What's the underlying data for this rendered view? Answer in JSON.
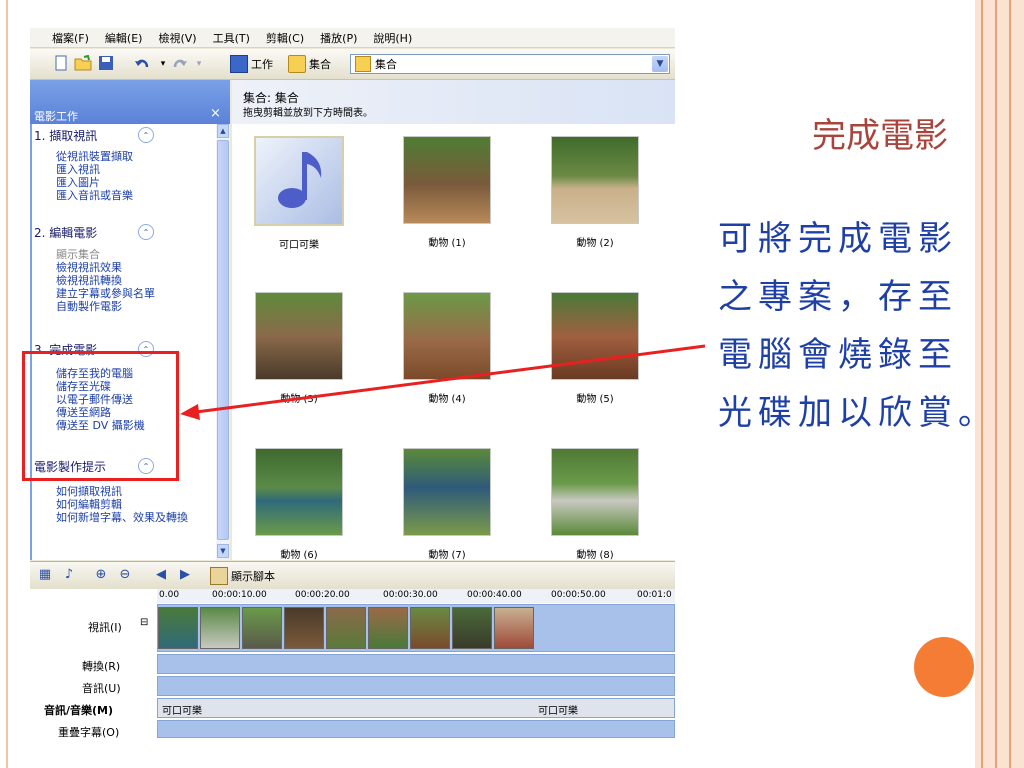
{
  "slide": {
    "title": "完成電影",
    "body_lines": [
      "可將完成電影",
      "之專案，存至",
      "電腦會燒錄至",
      "光碟加以欣賞。"
    ]
  },
  "colors": {
    "accent_orange": "#f47c35",
    "title_red": "#a8443c",
    "body_blue": "#1e3fa5",
    "highlight_red": "#e82020"
  },
  "menubar": [
    "檔案(F)",
    "編輯(E)",
    "檢視(V)",
    "工具(T)",
    "剪輯(C)",
    "播放(P)",
    "說明(H)"
  ],
  "toolbar": {
    "icons": [
      "new-icon",
      "open-folder-icon",
      "save-icon",
      "undo-icon",
      "redo-icon"
    ],
    "tasks_label": "工作",
    "collections_label": "集合",
    "select_value": "集合"
  },
  "taskpane": {
    "title": "電影工作",
    "close": "×",
    "sections": [
      {
        "title": "1. 擷取視訊",
        "toggle": "⌃",
        "links": [
          "從視訊裝置擷取",
          "匯入視訊",
          "匯入圖片",
          "匯入音訊或音樂"
        ]
      },
      {
        "title": "2. 編輯電影",
        "toggle": "⌃",
        "links": [
          "顯示集合",
          "檢視視訊效果",
          "檢視視訊轉換",
          "建立字幕或參與名單",
          "自動製作電影"
        ]
      },
      {
        "title": "3. 完成電影",
        "toggle": "⌃",
        "links": [
          "儲存至我的電腦",
          "儲存至光碟",
          "以電子郵件傳送",
          "傳送至網路",
          "傳送至 DV 攝影機"
        ]
      },
      {
        "title": "電影製作提示",
        "toggle": "⌃",
        "links": [
          "如何擷取視訊",
          "如何編輯剪輯",
          "如何新增字幕、效果及轉換"
        ]
      }
    ]
  },
  "collection": {
    "title": "集合: 集合",
    "subtitle": "拖曳剪輯並放到下方時間表。",
    "clips": [
      "可口可樂",
      "動物 (1)",
      "動物 (2)",
      "動物 (3)",
      "動物 (4)",
      "動物 (5)",
      "動物 (6)",
      "動物 (7)",
      "動物 (8)"
    ]
  },
  "timeline": {
    "storyboard_label": "顯示腳本",
    "ruler": [
      "0.00",
      "00:00:10.00",
      "00:00:20.00",
      "00:00:30.00",
      "00:00:40.00",
      "00:00:50.00",
      "00:01:0"
    ],
    "tracks": [
      "視訊(I)",
      "轉換(R)",
      "音訊(U)",
      "音訊/音樂(M)",
      "重疊字幕(O)"
    ],
    "audio_clip": "可口可樂",
    "audio_clip2": "可口可樂"
  }
}
